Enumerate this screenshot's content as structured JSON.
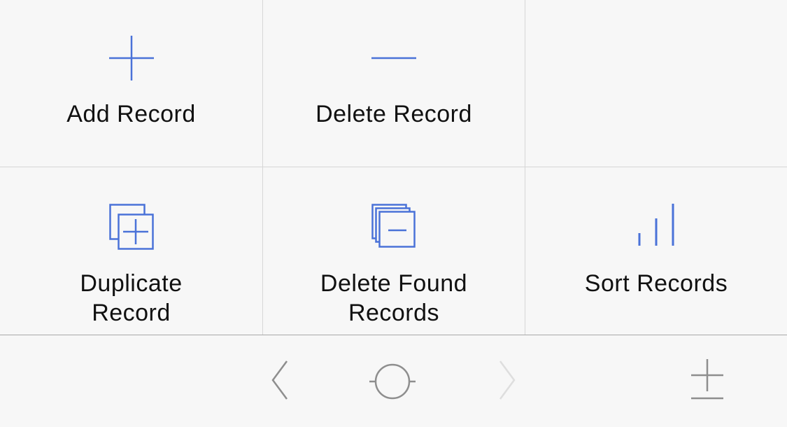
{
  "colors": {
    "accent": "#4a72d8",
    "toolbar_icon": "#8e8e8e",
    "toolbar_icon_disabled": "#dedede",
    "text": "#111111",
    "divider": "#d6d6d6",
    "background": "#f7f7f7"
  },
  "actions": {
    "add_record": {
      "label": "Add Record",
      "icon": "plus-icon"
    },
    "delete_record": {
      "label": "Delete Record",
      "icon": "minus-icon"
    },
    "duplicate_record": {
      "label_line1": "Duplicate",
      "label_line2": "Record",
      "icon": "duplicate-record-icon"
    },
    "delete_found_records": {
      "label_line1": "Delete Found",
      "label_line2": "Records",
      "icon": "delete-found-records-icon"
    },
    "sort_records": {
      "label": "Sort Records",
      "icon": "sort-bars-icon"
    }
  },
  "toolbar": {
    "back": {
      "icon": "chevron-left-icon",
      "enabled": true
    },
    "home": {
      "icon": "circle-target-icon",
      "enabled": true
    },
    "forward": {
      "icon": "chevron-right-icon",
      "enabled": false
    },
    "plus_minus": {
      "icon": "plus-minus-icon",
      "enabled": true
    }
  }
}
